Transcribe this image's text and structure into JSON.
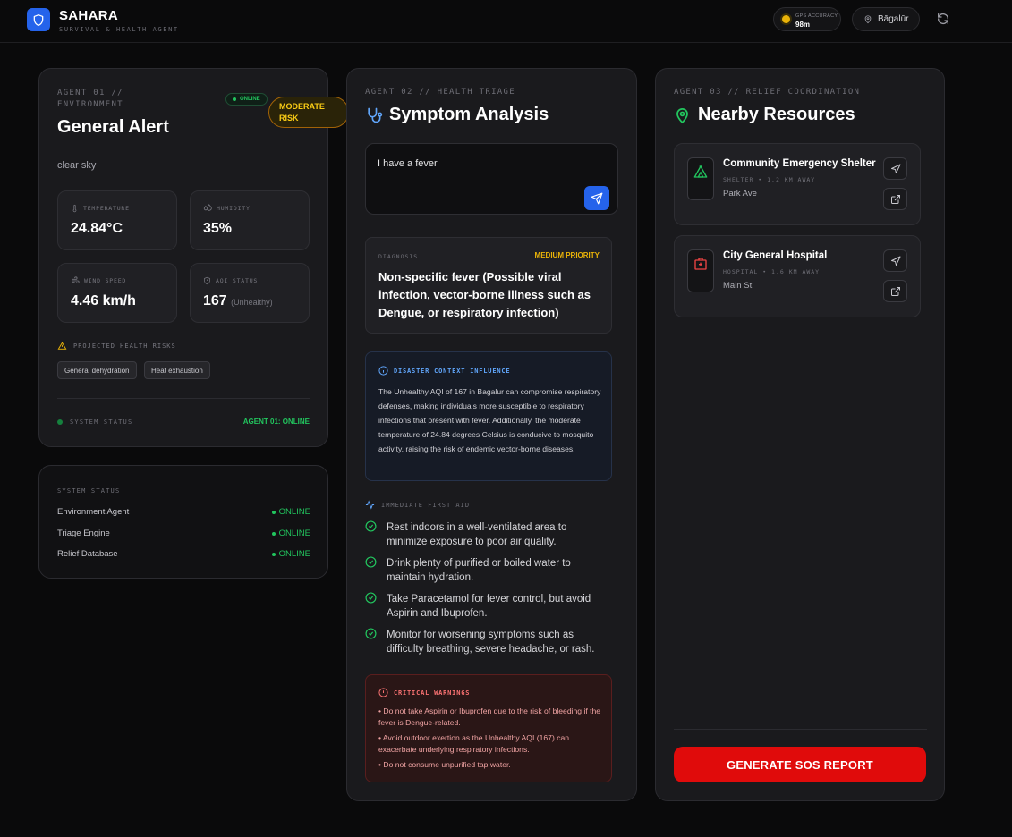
{
  "header": {
    "title": "SAHARA",
    "subtitle": "SURVIVAL & HEALTH AGENT",
    "gps_label": "GPS ACCURACY",
    "gps_value": "98m",
    "location": "Bāgalūr",
    "colors": {
      "brand": "#2563eb",
      "gps_dot": "#eab308"
    }
  },
  "agent1": {
    "eyebrow": "AGENT 01 // ENVIRONMENT",
    "status_pill": "ONLINE",
    "title": "General Alert",
    "risk_pill": "MODERATE RISK",
    "weather": "clear sky",
    "stats": [
      {
        "label": "TEMPERATURE",
        "value": "24.84°C",
        "icon": "thermometer-icon"
      },
      {
        "label": "HUMIDITY",
        "value": "35%",
        "icon": "droplets-icon"
      },
      {
        "label": "WIND SPEED",
        "value": "4.46 km/h",
        "icon": "wind-icon"
      },
      {
        "label": "AQI STATUS",
        "value": "167",
        "sub": "(Unhealthy)",
        "icon": "shield-icon"
      }
    ],
    "risks_title": "PROJECTED HEALTH RISKS",
    "risks": [
      "General dehydration",
      "Heat exhaustion"
    ],
    "system_label": "SYSTEM STATUS",
    "system_value": "AGENT 01: ONLINE"
  },
  "system_status": {
    "title": "SYSTEM STATUS",
    "rows": [
      {
        "name": "Environment Agent",
        "status": "ONLINE"
      },
      {
        "name": "Triage Engine",
        "status": "ONLINE"
      },
      {
        "name": "Relief Database",
        "status": "ONLINE"
      }
    ]
  },
  "agent2": {
    "eyebrow": "AGENT 02 // HEALTH TRIAGE",
    "title": "Symptom Analysis",
    "input_value": "I have a fever",
    "diagnosis_label": "DIAGNOSIS",
    "priority": "MEDIUM PRIORITY",
    "diagnosis": "Non-specific fever (Possible viral infection, vector-borne illness such as Dengue, or respiratory infection)",
    "context_title": "DISASTER CONTEXT INFLUENCE",
    "context_body": "The Unhealthy AQI of 167 in Bagalur can compromise respiratory defenses, making individuals more susceptible to respiratory infections that present with fever. Additionally, the moderate temperature of 24.84 degrees Celsius is conducive to mosquito activity, raising the risk of endemic vector-borne diseases.",
    "first_aid_title": "IMMEDIATE FIRST AID",
    "first_aid": [
      "Rest indoors in a well-ventilated area to minimize exposure to poor air quality.",
      "Drink plenty of purified or boiled water to maintain hydration.",
      "Take Paracetamol for fever control, but avoid Aspirin and Ibuprofen.",
      "Monitor for worsening symptoms such as difficulty breathing, severe headache, or rash."
    ],
    "warnings_title": "CRITICAL WARNINGS",
    "warnings": [
      "• Do not take Aspirin or Ibuprofen due to the risk of bleeding if the fever is Dengue-related.",
      "• Avoid outdoor exertion as the Unhealthy AQI (167) can exacerbate underlying respiratory infections.",
      "• Do not consume unpurified tap water."
    ]
  },
  "agent3": {
    "eyebrow": "AGENT 03 // RELIEF COORDINATION",
    "title": "Nearby Resources",
    "resources": [
      {
        "name": "Community Emergency Shelter",
        "meta": "SHELTER • 1.2 KM AWAY",
        "address": "Park Ave",
        "icon": "tent-icon"
      },
      {
        "name": "City General Hospital",
        "meta": "HOSPITAL • 1.6 KM AWAY",
        "address": "Main St",
        "icon": "hospital-icon"
      }
    ],
    "sos_label": "GENERATE SOS REPORT"
  }
}
